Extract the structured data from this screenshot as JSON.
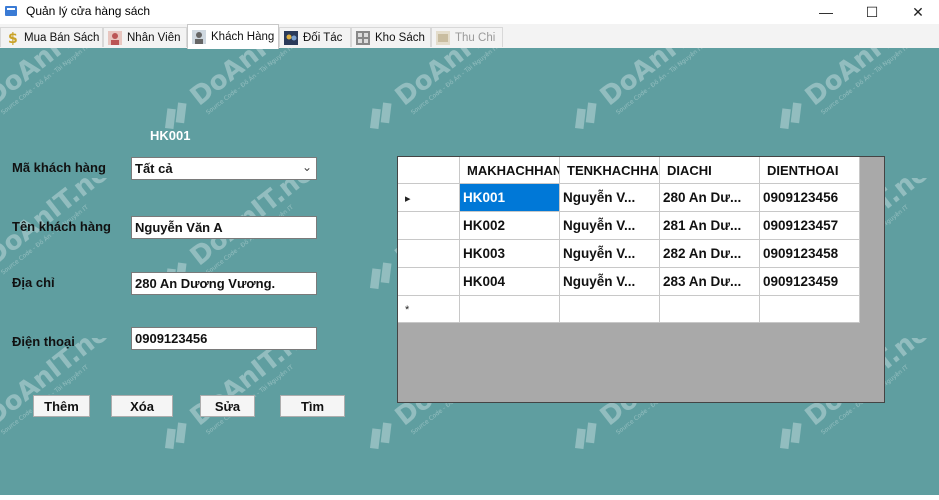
{
  "window": {
    "title": "Quản lý cửa hàng sách",
    "minimize": "—",
    "maximize": "☐",
    "close": "✕"
  },
  "tabs": [
    {
      "label": "Mua Bán Sách",
      "icon": "dollar-icon"
    },
    {
      "label": "Nhân Viên",
      "icon": "person-icon"
    },
    {
      "label": "Khách Hàng",
      "icon": "customer-icon",
      "active": true
    },
    {
      "label": "Đối Tác",
      "icon": "partner-icon"
    },
    {
      "label": "Kho Sách",
      "icon": "warehouse-icon"
    },
    {
      "label": "Thu Chi",
      "icon": "finance-icon",
      "disabled": true
    }
  ],
  "form": {
    "current_id": "HK001",
    "customer_id_label": "Mã khách hàng",
    "customer_id_value": "Tất cả",
    "name_label": "Tên khách hàng",
    "name_value": "Nguyễn Văn A",
    "address_label": "Địa chỉ",
    "address_value": "280 An Dương Vương.",
    "phone_label": "Điện thoại",
    "phone_value": "0909123456"
  },
  "buttons": {
    "add": "Thêm",
    "delete": "Xóa",
    "edit": "Sửa",
    "search": "Tìm"
  },
  "grid": {
    "columns": [
      "MAKHACHHANG",
      "TENKHACHHANG",
      "DIACHI",
      "DIENTHOAI"
    ],
    "rows": [
      [
        "HK001",
        "Nguyễn V...",
        "280 An Dư...",
        "0909123456"
      ],
      [
        "HK002",
        "Nguyễn V...",
        "281 An Dư...",
        "0909123457"
      ],
      [
        "HK003",
        "Nguyễn V...",
        "282 An Dư...",
        "0909123458"
      ],
      [
        "HK004",
        "Nguyễn V...",
        "283 An Dư...",
        "0909123459"
      ]
    ],
    "current_row_marker": "▸",
    "new_row_marker": "*",
    "selected_color": "#0078d7"
  },
  "watermark": {
    "text": "DoAnIT.net"
  },
  "colors": {
    "background": "#5f9ea0",
    "id_label": "#ffffff"
  }
}
